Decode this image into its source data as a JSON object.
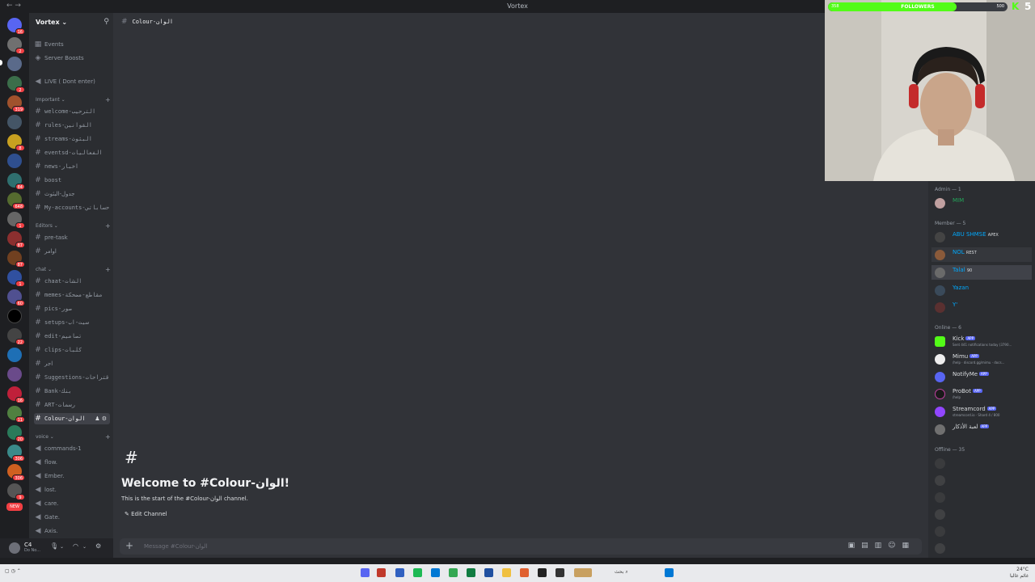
{
  "window": {
    "title": "Vortex",
    "back_icon": "arrow-left-icon",
    "forward_icon": "arrow-right-icon"
  },
  "server": {
    "name": "Vortex"
  },
  "sidebar": {
    "top": [
      {
        "icon": "calendar-icon",
        "label": "Events"
      },
      {
        "icon": "boost-icon",
        "label": "Server Boosts"
      }
    ],
    "live": {
      "icon": "speaker-icon",
      "label": "LIVE ( Dont enter)"
    },
    "categories": [
      {
        "name": "Important",
        "channels": [
          {
            "label": "welcome-الترحيب"
          },
          {
            "label": "rules-القوانين"
          },
          {
            "label": "streams-البثوث"
          },
          {
            "label": "eventsd-الفعاليات"
          },
          {
            "label": "news-اخبار"
          },
          {
            "label": "boost"
          },
          {
            "label": "جدول-البثوث"
          },
          {
            "label": "My-accounts-حساباتي"
          }
        ]
      },
      {
        "name": "Editors",
        "channels": [
          {
            "label": "pre-task"
          },
          {
            "label": "اوامر"
          }
        ]
      },
      {
        "name": "chat",
        "channels": [
          {
            "label": "chaat-الشات"
          },
          {
            "label": "memes-مقاطع-مضحكة"
          },
          {
            "label": "pics-صور"
          },
          {
            "label": "setups-سيت-اب"
          },
          {
            "label": "edit-تصاميم"
          },
          {
            "label": "clips-كلبات"
          },
          {
            "label": "اجر"
          },
          {
            "label": "Suggestions-اقتراحات"
          },
          {
            "label": "Bank-بنك"
          },
          {
            "label": "ART-رسمات"
          },
          {
            "label": "Colour-الوان"
          }
        ]
      },
      {
        "name": "voice",
        "channels": [
          {
            "label": "commands-1"
          },
          {
            "label": "flow."
          },
          {
            "label": "Ember."
          },
          {
            "label": "lost."
          },
          {
            "label": "care."
          },
          {
            "label": "Gate."
          },
          {
            "label": "Axis."
          }
        ]
      }
    ]
  },
  "user": {
    "name": "C4",
    "status": "Do No..."
  },
  "channel": {
    "name": "Colour-الوان",
    "welcome_title": "Welcome to #Colour-الوان!",
    "welcome_sub": "This is the start of the #Colour-الوان channel.",
    "edit_label": "Edit Channel",
    "composer_placeholder": "Message #Colour-الوان"
  },
  "members": {
    "groups": [
      {
        "title": "Admin — 1",
        "items": [
          {
            "name": "MIM",
            "color": "#23a55a"
          }
        ]
      },
      {
        "title": "Member — 5",
        "items": [
          {
            "name": "ABU SHMSE",
            "color": "#00a8fc",
            "tag": "APEX"
          },
          {
            "name": "NOL",
            "color": "#00a8fc",
            "tag": "REST"
          },
          {
            "name": "Talal",
            "color": "#00a8fc",
            "tag": "90"
          },
          {
            "name": "Yazan",
            "color": "#00a8fc"
          },
          {
            "name": "Y'",
            "color": "#00a8fc"
          }
        ]
      },
      {
        "title": "Online — 6",
        "items": [
          {
            "name": "Kick",
            "color": "#dbdee1",
            "app": "APP",
            "activity": "Sent 441 notifications today (3790..."
          },
          {
            "name": "Mimu",
            "color": "#dbdee1",
            "app": "APP",
            "activity": "/help · discord.gg/mimu · docs..."
          },
          {
            "name": "NotifyMe",
            "color": "#dbdee1",
            "app": "APP"
          },
          {
            "name": "ProBot",
            "color": "#dbdee1",
            "app": "APP",
            "activity": "/help"
          },
          {
            "name": "Streamcord",
            "color": "#dbdee1",
            "app": "APP",
            "activity": "streamcord.io · Shard 4 / 800"
          },
          {
            "name": "لعبة الأذكار",
            "color": "#dbdee1",
            "app": "APP"
          }
        ]
      },
      {
        "title": "Offline — 35"
      }
    ],
    "app_label": "APP"
  },
  "stream_overlay": {
    "followers_label": "FOLLOWERS",
    "followers_current": "358",
    "followers_goal": "500",
    "followers_progress": 0.716,
    "k_count": "5",
    "accent": "#53fc18"
  },
  "taskbar": {
    "search": "بحث",
    "date": "24°C",
    "weather_note": "غائم غالبا"
  }
}
